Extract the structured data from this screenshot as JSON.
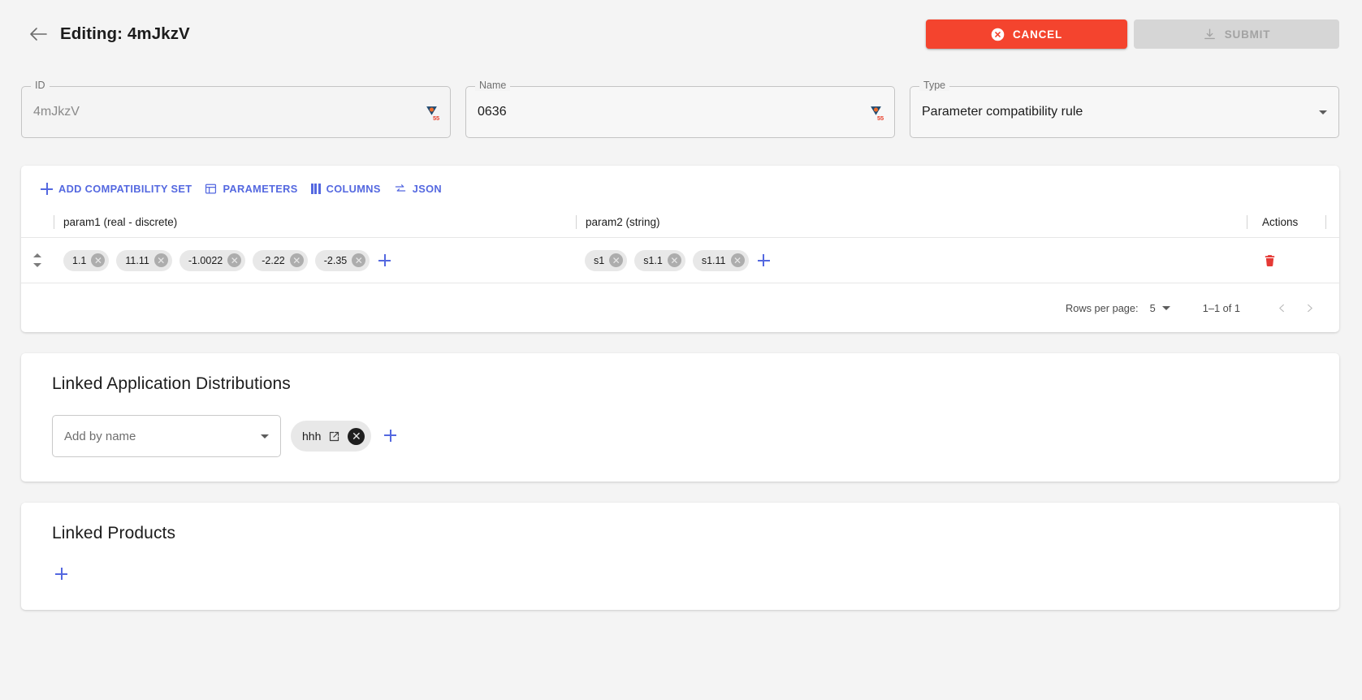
{
  "header": {
    "back_icon": "arrow-left-icon",
    "title": "Editing: 4mJkzV",
    "cancel_label": "CANCEL",
    "cancel_icon": "cancel-circle-icon",
    "cancel_color": "#f4442e",
    "submit_label": "SUBMIT",
    "submit_icon": "download-icon",
    "submit_disabled_color": "#d6d6d6"
  },
  "fields": {
    "id": {
      "label": "ID",
      "value": "4mJkzV",
      "disabled": true,
      "badge": "55"
    },
    "name": {
      "label": "Name",
      "value": "0636",
      "badge": "55"
    },
    "type": {
      "label": "Type",
      "value": "Parameter compatibility rule",
      "dropdown_icon": "chevron-down-icon"
    }
  },
  "grid": {
    "toolbar": [
      {
        "label": "ADD COMPATIBILITY SET",
        "icon": "plus-icon"
      },
      {
        "label": "PARAMETERS",
        "icon": "table-icon"
      },
      {
        "label": "COLUMNS",
        "icon": "columns-icon"
      },
      {
        "label": "JSON",
        "icon": "swap-arrows-icon"
      }
    ],
    "columns": [
      "param1 (real - discrete)",
      "param2 (string)",
      "Actions"
    ],
    "rows": [
      {
        "param1": [
          "1.1",
          "11.11",
          "-1.0022",
          "-2.22",
          "-2.35"
        ],
        "param2": [
          "s1",
          "s1.1",
          "s1.11"
        ],
        "delete_icon": "trash-icon",
        "reorder_icon": "reorder-updown-icon"
      }
    ],
    "add_value_icon": "plus-icon",
    "pagination": {
      "rows_per_page_label": "Rows per page:",
      "rows_per_page_value": "5",
      "range": "1–1 of 1",
      "prev_icon": "chevron-left-icon",
      "next_icon": "chevron-right-icon"
    }
  },
  "linked_distributions": {
    "title": "Linked Application Distributions",
    "select_placeholder": "Add by name",
    "select_icon": "chevron-down-icon",
    "chips": [
      {
        "label": "hhh",
        "open_icon": "launch-icon",
        "remove_icon": "close-circle-icon"
      }
    ],
    "add_icon": "plus-icon"
  },
  "linked_products": {
    "title": "Linked Products",
    "add_icon": "plus-icon"
  },
  "colors": {
    "accent": "#5468e0",
    "danger": "#e53935",
    "cancel": "#f4442e"
  }
}
